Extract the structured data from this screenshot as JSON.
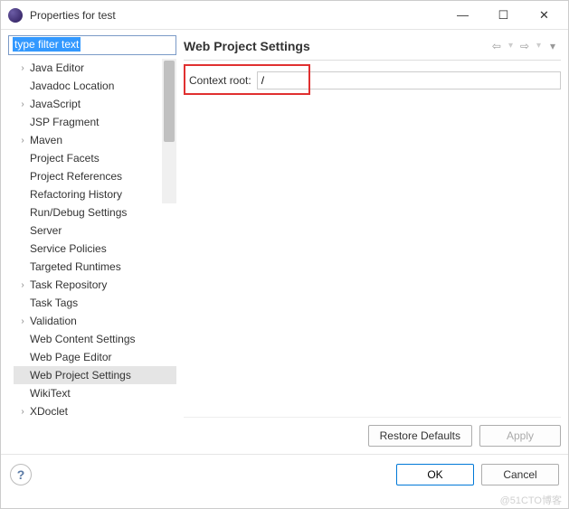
{
  "window": {
    "title": "Properties for test"
  },
  "filter": {
    "placeholder": "type filter text",
    "value": "type filter text"
  },
  "tree": {
    "items": [
      {
        "label": "Java Editor",
        "expandable": true
      },
      {
        "label": "Javadoc Location",
        "expandable": false
      },
      {
        "label": "JavaScript",
        "expandable": true
      },
      {
        "label": "JSP Fragment",
        "expandable": false
      },
      {
        "label": "Maven",
        "expandable": true
      },
      {
        "label": "Project Facets",
        "expandable": false
      },
      {
        "label": "Project References",
        "expandable": false
      },
      {
        "label": "Refactoring History",
        "expandable": false
      },
      {
        "label": "Run/Debug Settings",
        "expandable": false
      },
      {
        "label": "Server",
        "expandable": false
      },
      {
        "label": "Service Policies",
        "expandable": false
      },
      {
        "label": "Targeted Runtimes",
        "expandable": false
      },
      {
        "label": "Task Repository",
        "expandable": true
      },
      {
        "label": "Task Tags",
        "expandable": false
      },
      {
        "label": "Validation",
        "expandable": true
      },
      {
        "label": "Web Content Settings",
        "expandable": false
      },
      {
        "label": "Web Page Editor",
        "expandable": false
      },
      {
        "label": "Web Project Settings",
        "expandable": false,
        "selected": true
      },
      {
        "label": "WikiText",
        "expandable": false
      },
      {
        "label": "XDoclet",
        "expandable": true
      }
    ]
  },
  "page": {
    "title": "Web Project Settings",
    "context_root_label": "Context root:",
    "context_root_value": "/"
  },
  "buttons": {
    "restore_defaults": "Restore Defaults",
    "apply": "Apply",
    "ok": "OK",
    "cancel": "Cancel"
  },
  "watermark": "@51CTO博客"
}
